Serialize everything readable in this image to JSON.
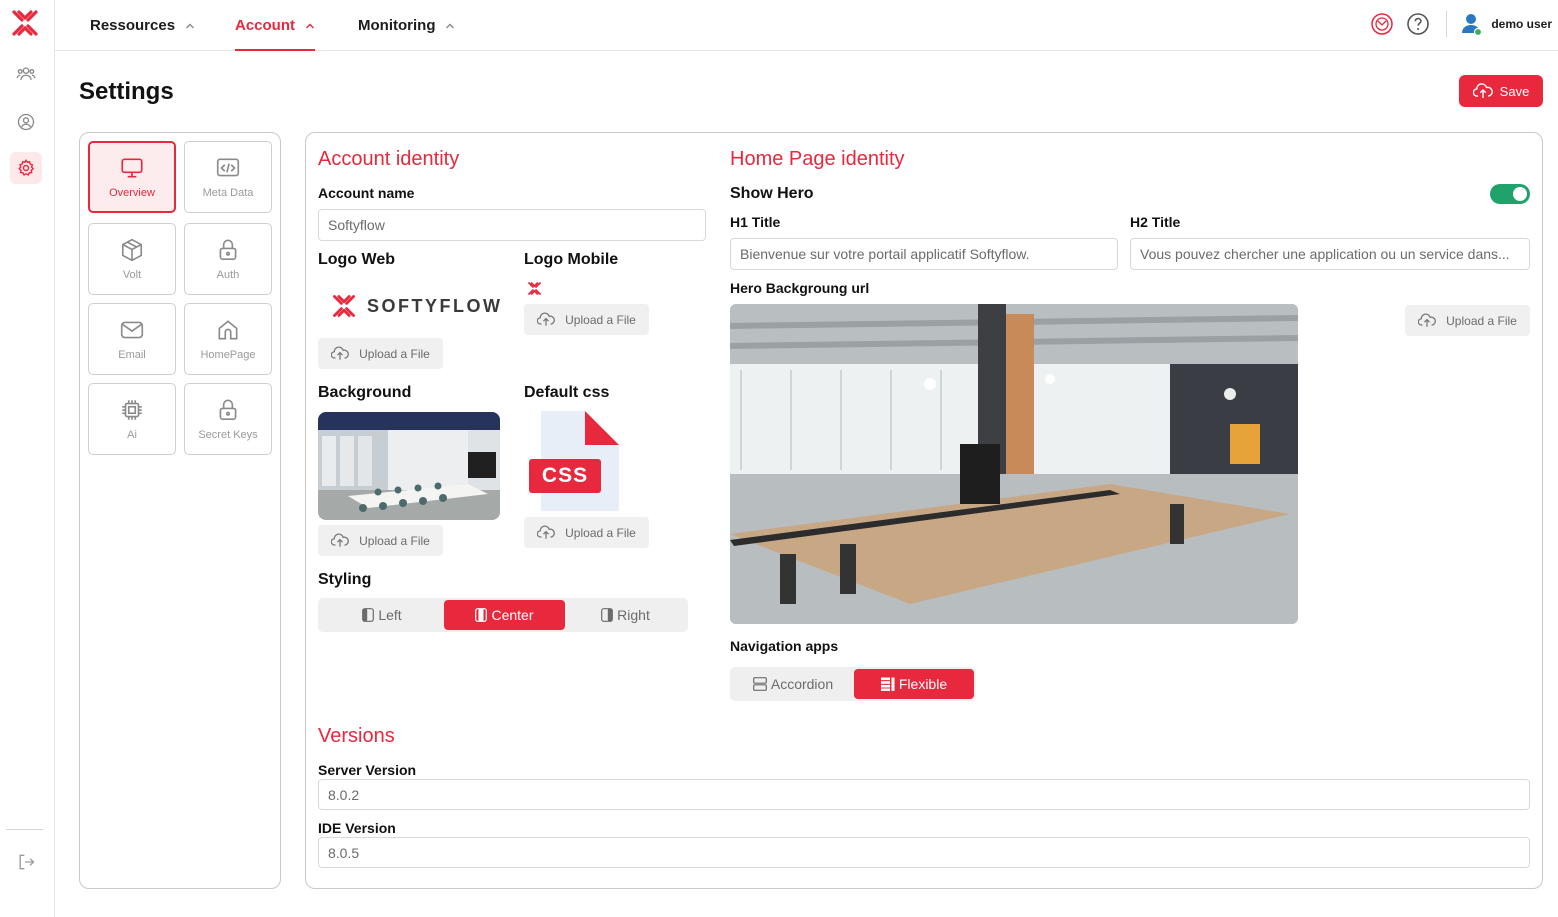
{
  "app": {
    "brand_color": "#e8283d"
  },
  "rail": {
    "items": [
      {
        "icon": "users-icon"
      },
      {
        "icon": "user-circle-icon"
      },
      {
        "icon": "gear-icon",
        "active": true
      }
    ],
    "logout_icon": "logout-icon"
  },
  "topnav": {
    "items": [
      {
        "label": "Ressources"
      },
      {
        "label": "Account",
        "active": true
      },
      {
        "label": "Monitoring"
      }
    ],
    "user": {
      "name": "demo user"
    }
  },
  "page": {
    "title": "Settings",
    "save_label": "Save"
  },
  "sidebar": {
    "tiles": [
      {
        "label": "Overview",
        "icon": "monitor-icon",
        "active": true
      },
      {
        "label": "Meta Data",
        "icon": "code-icon"
      },
      {
        "label": "Volt",
        "icon": "box-icon"
      },
      {
        "label": "Auth",
        "icon": "lock-icon"
      },
      {
        "label": "Email",
        "icon": "mail-icon"
      },
      {
        "label": "HomePage",
        "icon": "home-icon"
      },
      {
        "label": "Ai",
        "icon": "chip-icon"
      },
      {
        "label": "Secret Keys",
        "icon": "lock-icon"
      }
    ]
  },
  "account_identity": {
    "title": "Account identity",
    "account_name_label": "Account name",
    "account_name_value": "Softyflow",
    "logo_web_label": "Logo Web",
    "logo_web_text": "SOFTYFLOW",
    "logo_mobile_label": "Logo Mobile",
    "background_label": "Background",
    "default_css_label": "Default css",
    "css_badge": "CSS",
    "upload_label": "Upload a File",
    "styling_label": "Styling",
    "styling_options": [
      "Left",
      "Center",
      "Right"
    ],
    "styling_selected": "Center"
  },
  "home_identity": {
    "title": "Home Page identity",
    "show_hero_label": "Show Hero",
    "show_hero_on": true,
    "h1_label": "H1 Title",
    "h1_value": "Bienvenue sur votre portail applicatif Softyflow.",
    "h2_label": "H2 Title",
    "h2_value": "Vous pouvez chercher une application ou un service dans...",
    "hero_bg_label": "Hero Backgroung url",
    "upload_label": "Upload a File",
    "nav_apps_label": "Navigation apps",
    "nav_options": [
      "Accordion",
      "Flexible"
    ],
    "nav_selected": "Flexible"
  },
  "versions": {
    "title": "Versions",
    "server_label": "Server Version",
    "server_value": "8.0.2",
    "ide_label": "IDE Version",
    "ide_value": "8.0.5"
  }
}
